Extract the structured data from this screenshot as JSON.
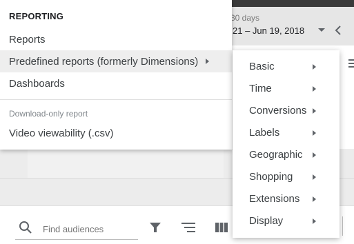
{
  "date_picker": {
    "range_label": "30 days",
    "range_value": "21 – Jun 19, 2018"
  },
  "reporting_menu": {
    "heading": "REPORTING",
    "items": [
      {
        "label": "Reports",
        "has_submenu": false
      },
      {
        "label": "Predefined reports (formerly Dimensions)",
        "has_submenu": true,
        "active": true
      },
      {
        "label": "Dashboards",
        "has_submenu": false
      }
    ],
    "download_heading": "Download-only report",
    "download_items": [
      {
        "label": "Video viewability (.csv)"
      }
    ]
  },
  "predefined_submenu": {
    "items": [
      {
        "label": "Basic"
      },
      {
        "label": "Time"
      },
      {
        "label": "Conversions"
      },
      {
        "label": "Labels"
      },
      {
        "label": "Geographic"
      },
      {
        "label": "Shopping"
      },
      {
        "label": "Extensions"
      },
      {
        "label": "Display"
      }
    ]
  },
  "audience_toolbar": {
    "search_placeholder": "Find audiences",
    "icons": [
      "search-icon",
      "filter-icon",
      "sort-icon",
      "columns-icon"
    ]
  },
  "colors": {
    "menu_hover_bg": "#eeeeee",
    "text_primary": "#3c4043",
    "text_secondary": "#80868b",
    "header_bg": "#e6e6e6"
  }
}
